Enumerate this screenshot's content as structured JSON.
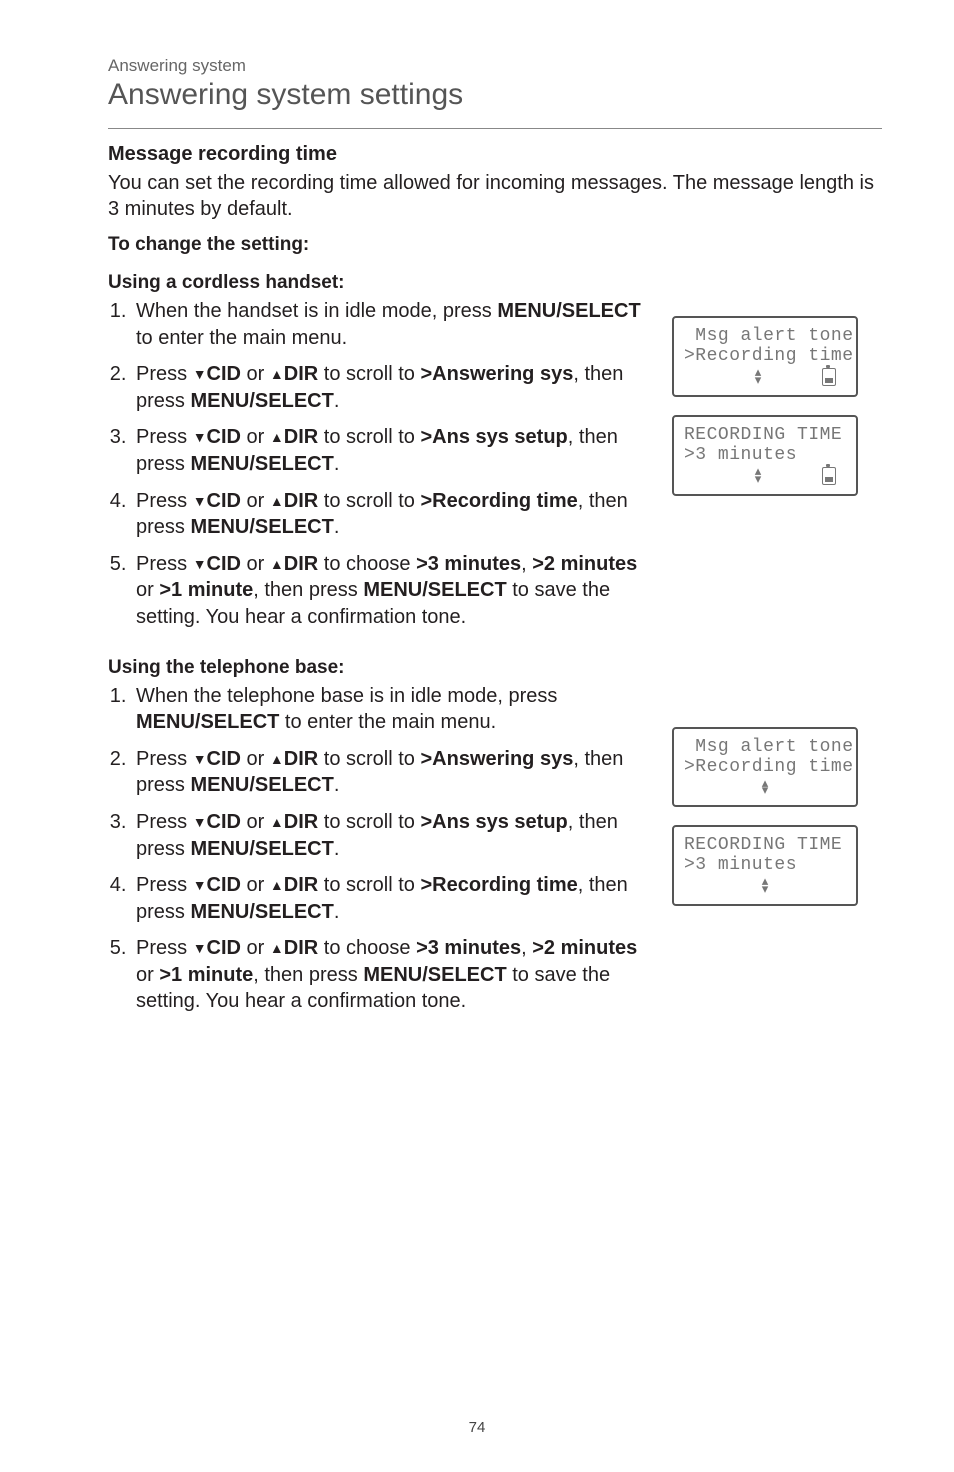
{
  "page_number": "74",
  "breadcrumb": "Answering system",
  "heading": "Answering system settings",
  "s1": {
    "title": "Message recording time",
    "body": "You can set the recording time allowed for incoming messages. The message length is 3 minutes by default.",
    "to_change": "To change the setting:",
    "handset_title": "Using a cordless handset:",
    "base_title": "Using the telephone base:",
    "menu_select_sc": "MENU/",
    "select_small": "SELECT",
    "cid": "CID",
    "dir": "DIR",
    "ans_sys": ">Answering sys",
    "ans_setup": ">Ans sys setup",
    "rec_time": ">Recording time",
    "m3": ">3 minutes",
    "m2": ">2 minutes",
    "m1": ">1 minute",
    "menu_select_b": "MENU/SELECT",
    "step_h1_a": "When the handset is in idle mode, press ",
    "step_h1_b": " to enter the main menu.",
    "press": "Press ",
    "or": " or ",
    "scroll_to": " to scroll to ",
    "then_press": ", then press ",
    "period": ".",
    "to_choose": " to choose ",
    "comma_sp": ", ",
    "save_tail": " to save the setting. You hear a confirmation tone.",
    "step_b1_a": "When the telephone base is in idle mode, press ",
    "step_b1_b": " to enter the main menu."
  },
  "lcd": {
    "msg_alert": " Msg alert tone",
    "rec_time": ">Recording time",
    "rec_title": "RECORDING TIME",
    "m3": ">3 minutes"
  }
}
